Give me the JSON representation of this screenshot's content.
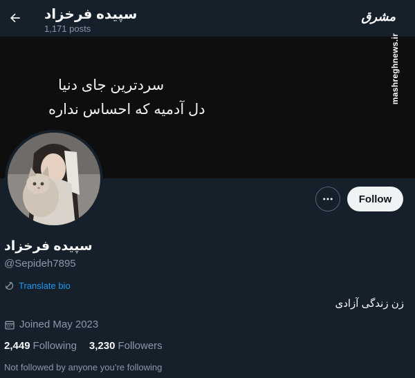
{
  "header": {
    "title": "سپیده فرخزاد",
    "posts_count": "1,171 posts"
  },
  "watermark": {
    "logo": "مشرق",
    "url": "mashreghnews.ir"
  },
  "banner": {
    "line1": "سردترین جای دنیا",
    "line2": "دل آدمیه که احساس نداره"
  },
  "actions": {
    "follow_label": "Follow"
  },
  "profile": {
    "display_name": "سپیده فرخزاد",
    "handle": "@Sepideh7895",
    "translate_label": "Translate bio",
    "bio": "زن زندگی آزادی",
    "joined": "Joined May 2023",
    "following_count": "2,449",
    "following_label": "Following",
    "followers_count": "3,230",
    "followers_label": "Followers",
    "not_followed_text": "Not followed by anyone you’re following"
  },
  "colors": {
    "background": "#15202b",
    "accent": "#1d9bf0",
    "muted_text": "#8b98a5",
    "button_bg": "#eff3f4"
  }
}
